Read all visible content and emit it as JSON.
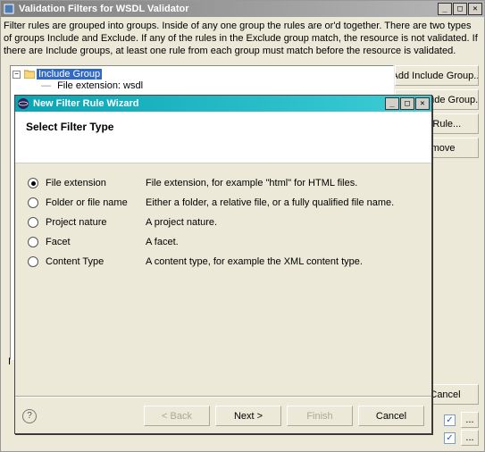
{
  "parent": {
    "title": "Validation Filters for WSDL Validator",
    "description": "Filter rules are grouped into groups. Inside of any one group the rules are or'd together. There are two types of groups Include and Exclude. If any of the rules in the Exclude group match, the resource is not validated. If there are Include groups, at least one rule from each group must match before the resource is validated.",
    "tree": {
      "group_label": "Include Group",
      "child_label": "File extension: wsdl"
    },
    "side_buttons": {
      "add_include": "Add Include Group...",
      "add_exclude": "Add Exclude Group...",
      "add_rule": "Add Rule...",
      "remove": "Remove"
    },
    "side_label": "I",
    "cancel": "Cancel",
    "ellipsis": "..."
  },
  "modal": {
    "title": "New Filter Rule Wizard",
    "header": "Select Filter Type",
    "options": [
      {
        "label": "File extension",
        "desc": "File extension, for example \"html\" for HTML files.",
        "selected": true
      },
      {
        "label": "Folder or file name",
        "desc": "Either a folder, a relative file, or a fully qualified file name.",
        "selected": false
      },
      {
        "label": "Project nature",
        "desc": "A project nature.",
        "selected": false
      },
      {
        "label": "Facet",
        "desc": "A facet.",
        "selected": false
      },
      {
        "label": "Content Type",
        "desc": "A content type, for example the XML content type.",
        "selected": false
      }
    ],
    "buttons": {
      "back": "< Back",
      "next": "Next >",
      "finish": "Finish",
      "cancel": "Cancel"
    },
    "help": "?"
  }
}
